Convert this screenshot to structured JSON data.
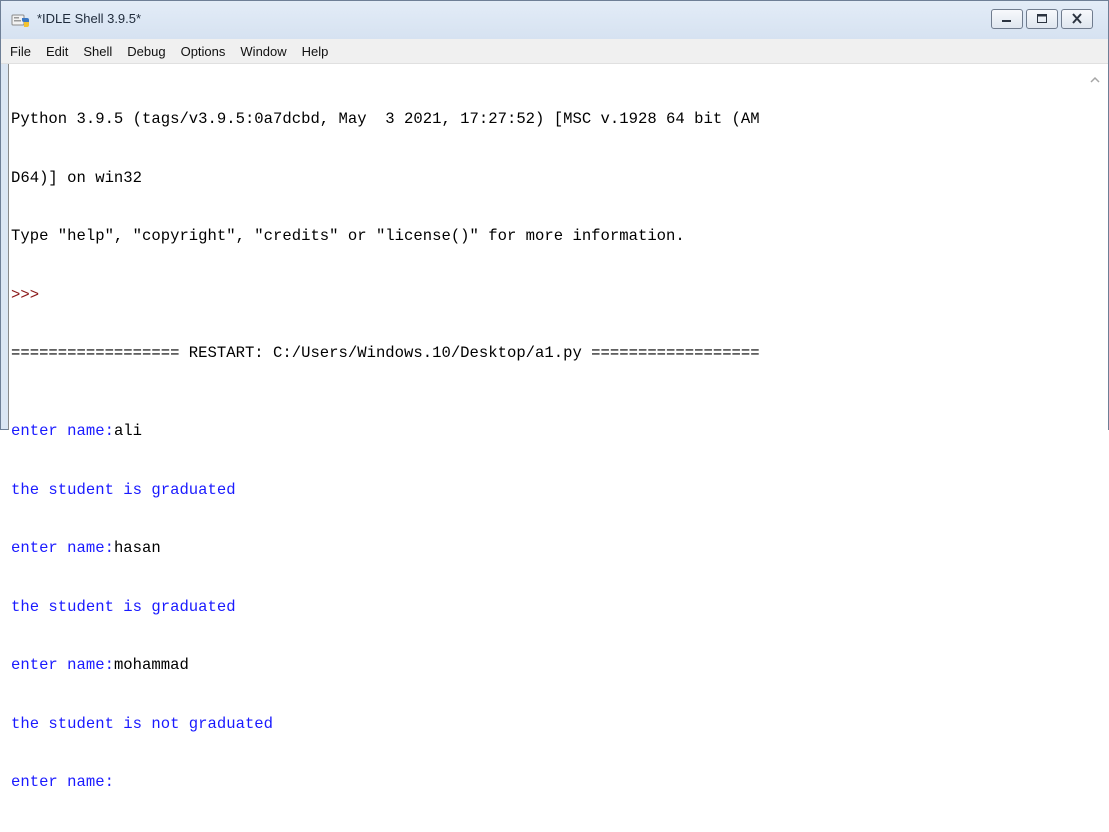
{
  "window": {
    "title": "*IDLE Shell 3.9.5*",
    "icon": "idle-python-icon",
    "controls": [
      "minimize-icon",
      "maximize-icon",
      "close-icon"
    ]
  },
  "menu": {
    "items": [
      "File",
      "Edit",
      "Shell",
      "Debug",
      "Options",
      "Window",
      "Help"
    ]
  },
  "shell": {
    "banner_line1": "Python 3.9.5 (tags/v3.9.5:0a7dcbd, May  3 2021, 17:27:52) [MSC v.1928 64 bit (AM",
    "banner_line2": "D64)] on win32",
    "banner_line3": "Type \"help\", \"copyright\", \"credits\" or \"license()\" for more information.",
    "prompt": ">>> ",
    "restart_line": "================== RESTART: C:/Users/Windows.10/Desktop/a1.py ==================",
    "session": [
      {
        "prompt_text": "enter name:",
        "input": "ali"
      },
      {
        "output": "the student is graduated"
      },
      {
        "prompt_text": "enter name:",
        "input": "hasan"
      },
      {
        "output": "the student is graduated"
      },
      {
        "prompt_text": "enter name:",
        "input": "mohammad"
      },
      {
        "output": "the student is not graduated"
      },
      {
        "prompt_text": "enter name:",
        "input": ""
      }
    ]
  },
  "colors": {
    "stdout": "#1a1aff",
    "stdin": "#000000",
    "prompt": "#8b1a1a",
    "titlebar": "#dbe6f3"
  }
}
